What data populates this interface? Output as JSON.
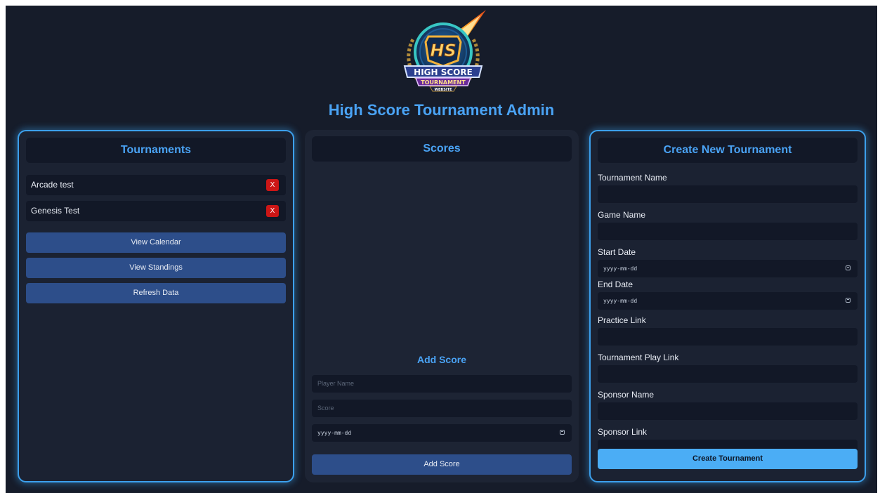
{
  "header": {
    "logo_text": "HS HIGH SCORE TOURNAMENT WEBSITE",
    "title": "High Score Tournament Admin"
  },
  "tournaments": {
    "heading": "Tournaments",
    "items": [
      {
        "name": "Arcade test",
        "delete_label": "X"
      },
      {
        "name": "Genesis Test",
        "delete_label": "X"
      }
    ],
    "buttons": {
      "calendar": "View Calendar",
      "standings": "View Standings",
      "refresh": "Refresh Data"
    }
  },
  "scores": {
    "heading": "Scores",
    "add_heading": "Add Score",
    "player_placeholder": "Player Name",
    "score_placeholder": "Score",
    "date_placeholder": "yyyy-mm-dd",
    "submit_label": "Add Score"
  },
  "create": {
    "heading": "Create New Tournament",
    "labels": {
      "tournament_name": "Tournament Name",
      "game_name": "Game Name",
      "start_date": "Start Date",
      "end_date": "End Date",
      "practice_link": "Practice Link",
      "play_link": "Tournament Play Link",
      "sponsor_name": "Sponsor Name",
      "sponsor_link": "Sponsor Link"
    },
    "date_placeholder": "yyyy-mm-dd",
    "submit_label": "Create Tournament"
  },
  "colors": {
    "accent": "#4aa3f5",
    "background": "#161c2a",
    "button": "#2d4e8a",
    "primary_button": "#4badf5",
    "danger": "#cc1616"
  }
}
